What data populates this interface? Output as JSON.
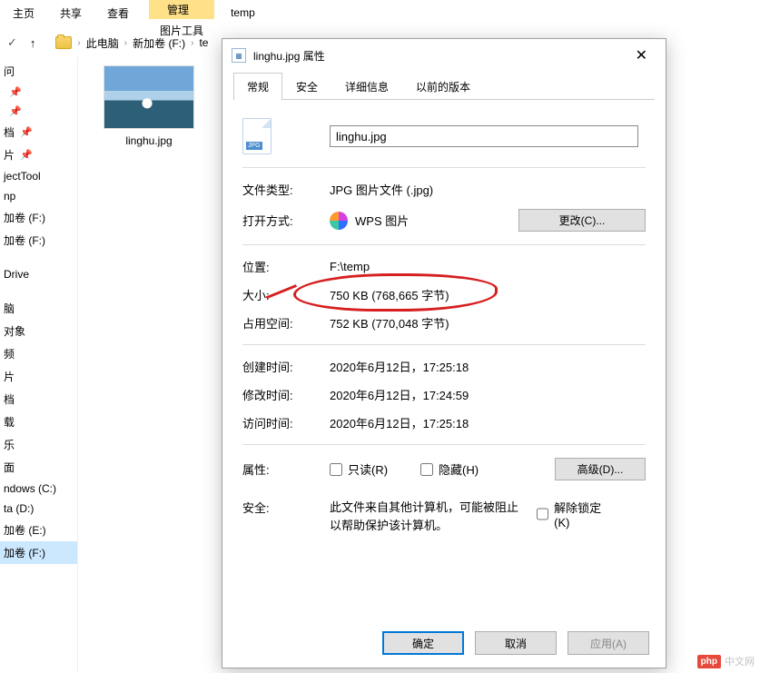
{
  "ribbon": {
    "tabs": [
      "主页",
      "共享",
      "查看"
    ],
    "context_tab": "管理",
    "context_group": "图片工具",
    "address_label": "temp"
  },
  "breadcrumb": {
    "items": [
      "此电脑",
      "新加卷 (F:)",
      "te"
    ]
  },
  "nav": {
    "items": [
      {
        "label": "问",
        "pinned": false
      },
      {
        "label": "",
        "pinned": true
      },
      {
        "label": "",
        "pinned": true
      },
      {
        "label": "档",
        "pinned": true
      },
      {
        "label": "片",
        "pinned": true
      },
      {
        "label": "jectTool",
        "pinned": false
      },
      {
        "label": "np",
        "pinned": false
      },
      {
        "label": "加卷 (F:)",
        "pinned": false
      },
      {
        "label": "加卷 (F:)",
        "pinned": false
      },
      {
        "label": "Drive",
        "pinned": false
      },
      {
        "label": "脑",
        "pinned": false
      },
      {
        "label": "对象",
        "pinned": false
      },
      {
        "label": "频",
        "pinned": false
      },
      {
        "label": "片",
        "pinned": false
      },
      {
        "label": "档",
        "pinned": false
      },
      {
        "label": "载",
        "pinned": false
      },
      {
        "label": "乐",
        "pinned": false
      },
      {
        "label": "面",
        "pinned": false
      },
      {
        "label": "ndows (C:)",
        "pinned": false
      },
      {
        "label": "ta (D:)",
        "pinned": false
      },
      {
        "label": "加卷 (E:)",
        "pinned": false
      },
      {
        "label": "加卷 (F:)",
        "pinned": false,
        "selected": true
      }
    ]
  },
  "file": {
    "name": "linghu.jpg"
  },
  "dialog": {
    "title": "linghu.jpg 属性",
    "tabs": [
      "常规",
      "安全",
      "详细信息",
      "以前的版本"
    ],
    "filename": "linghu.jpg",
    "labels": {
      "file_type": "文件类型:",
      "open_with": "打开方式:",
      "change": "更改(C)...",
      "location": "位置:",
      "size": "大小:",
      "size_on_disk": "占用空间:",
      "created": "创建时间:",
      "modified": "修改时间:",
      "accessed": "访问时间:",
      "attributes": "属性:",
      "readonly": "只读(R)",
      "hidden": "隐藏(H)",
      "advanced": "高级(D)...",
      "security": "安全:",
      "security_msg": "此文件来自其他计算机，可能被阻止以帮助保护该计算机。",
      "unlock": "解除锁定(K)"
    },
    "values": {
      "file_type": "JPG 图片文件 (.jpg)",
      "open_with": "WPS 图片",
      "location": "F:\\temp",
      "size": "750 KB (768,665 字节)",
      "size_on_disk": "752 KB (770,048 字节)",
      "created": "2020年6月12日，17:25:18",
      "modified": "2020年6月12日，17:24:59",
      "accessed": "2020年6月12日，17:25:18"
    },
    "buttons": {
      "ok": "确定",
      "cancel": "取消",
      "apply": "应用(A)"
    }
  },
  "watermark": {
    "brand": "php",
    "text": "中文网"
  }
}
